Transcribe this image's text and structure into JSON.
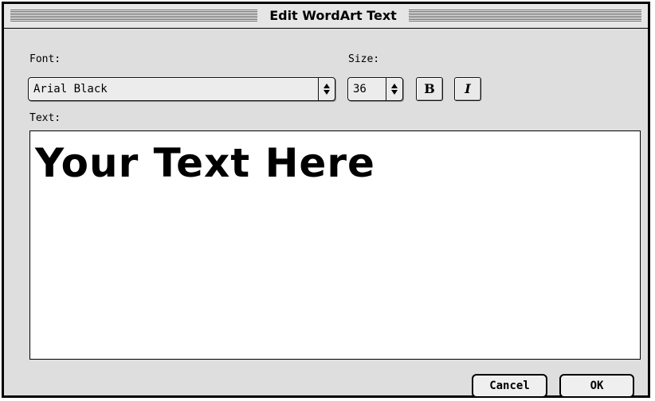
{
  "dialog": {
    "title": "Edit WordArt Text"
  },
  "font": {
    "label": "Font:",
    "value": "Arial Black"
  },
  "size": {
    "label": "Size:",
    "value": "36"
  },
  "format": {
    "bold_label": "B",
    "italic_label": "I"
  },
  "text": {
    "label": "Text:",
    "value": "Your Text Here"
  },
  "buttons": {
    "cancel": "Cancel",
    "ok": "OK"
  }
}
